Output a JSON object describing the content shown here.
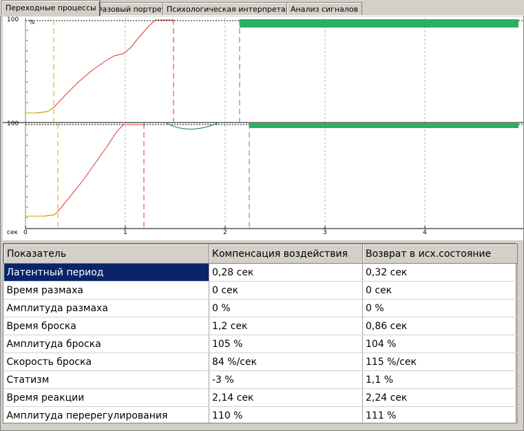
{
  "tabs": [
    {
      "label": "Переходные процессы",
      "active": true
    },
    {
      "label": "Фазовый портрет",
      "active": false
    },
    {
      "label": "Психологическая интерпретация",
      "active": false
    },
    {
      "label": "Анализ сигналов",
      "active": false
    }
  ],
  "plot": {
    "top_y_label": "100",
    "top_unit": "%",
    "bottom_y_label": "100",
    "x_unit": "сек",
    "x_ticks": [
      "0",
      "1",
      "2",
      "3",
      "4"
    ],
    "colors": {
      "curve": "#e03030",
      "latent_marker": "#e0a000",
      "throw_marker": "#e03030",
      "reaction_marker": "#4080c0",
      "overshoot_curve": "#208040",
      "band": "#2ab060",
      "grid": "#b0b0b0"
    }
  },
  "table": {
    "headers": [
      "Показатель",
      "Компенсация воздействия",
      "Возврат в исх.состояние"
    ],
    "rows": [
      [
        "Латентный период",
        "0,28 сек",
        "0,32 сек"
      ],
      [
        "Время размаха",
        "0 сек",
        "0 сек"
      ],
      [
        "Амплитуда размаха",
        "0 %",
        "0 %"
      ],
      [
        "Время броска",
        "1,2 сек",
        "0,86 сек"
      ],
      [
        "Амплитуда броска",
        "105 %",
        "104 %"
      ],
      [
        "Скорость броска",
        "84 %/сек",
        "115 %/сек"
      ],
      [
        "Статизм",
        "-3 %",
        "1,1 %"
      ],
      [
        "Время реакции",
        "2,14 сек",
        "2,24 сек"
      ],
      [
        "Амплитуда перерегулирования",
        "110 %",
        "111 %"
      ]
    ],
    "selected_row": 0
  }
}
